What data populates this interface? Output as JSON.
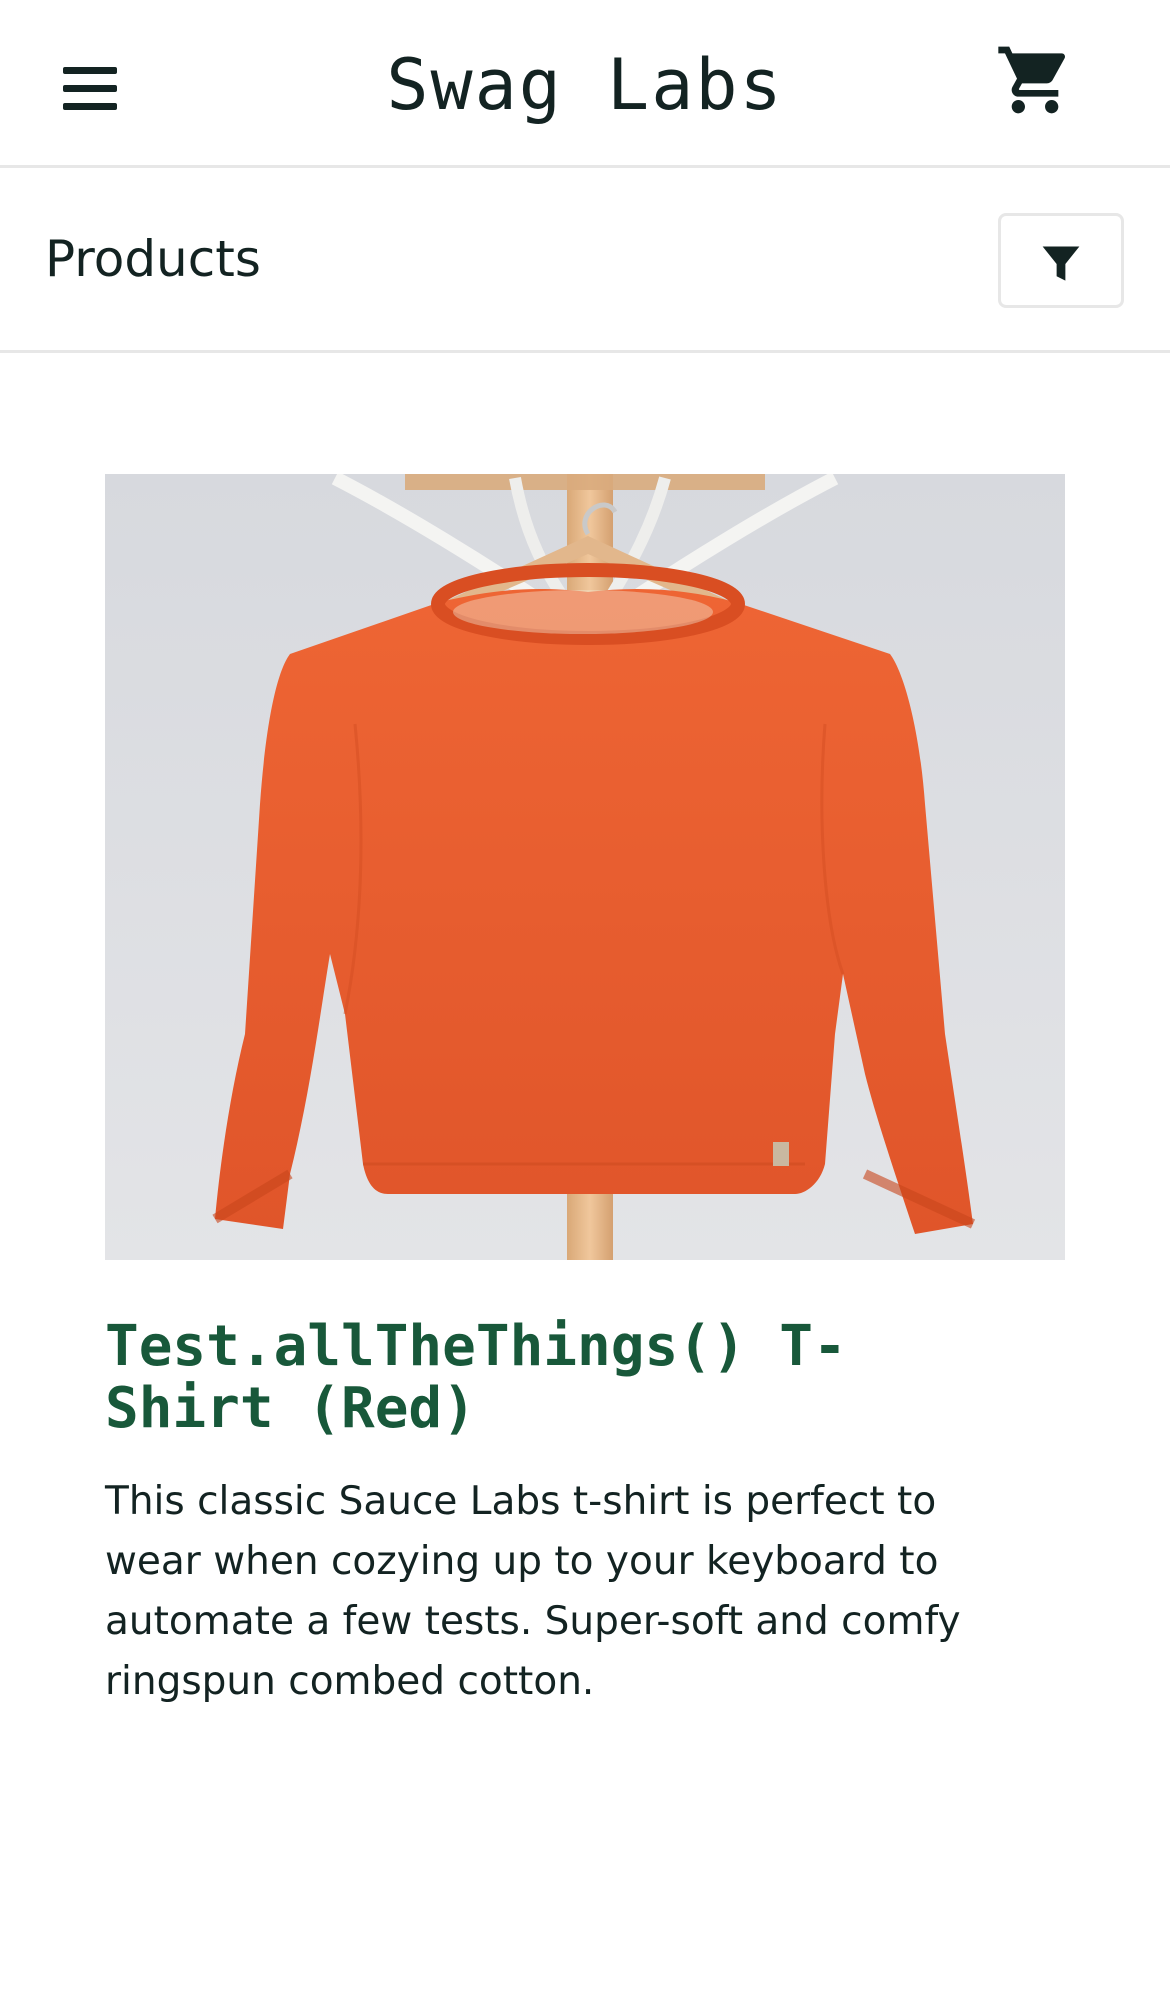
{
  "header": {
    "app_title": "Swag Labs",
    "menu_icon": "hamburger-menu-icon",
    "cart_icon": "shopping-cart-icon"
  },
  "sub_header": {
    "title": "Products",
    "filter_icon": "filter-funnel-icon"
  },
  "product": {
    "image_subject": "orange sweatshirt on wooden hanger",
    "name": "Test.allTheThings() T-Shirt (Red)",
    "description": "This classic Sauce Labs t-shirt is perfect to wear when cozying up to your keyboard to automate a few tests. Super-soft and comfy ringspun combed cotton."
  },
  "colors": {
    "text_primary": "#132322",
    "product_name": "#18583a",
    "divider": "#e7e7e7",
    "sweatshirt": "#e85a2c",
    "image_background": "#dcdde1"
  }
}
